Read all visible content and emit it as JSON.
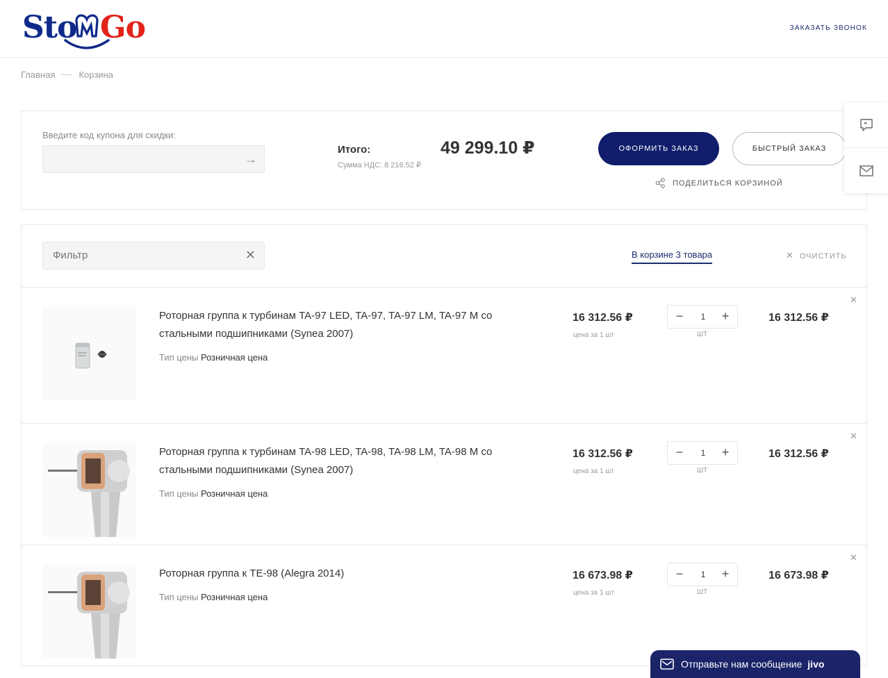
{
  "header": {
    "logo_text_left": "Sto",
    "logo_text_right": "Go",
    "call_link": "ЗАКАЗАТЬ ЗВОНОК"
  },
  "breadcrumb": {
    "home": "Главная",
    "current": "Корзина"
  },
  "summary": {
    "coupon_label": "Введите код купона для скидки:",
    "coupon_value": "",
    "total_label": "Итого:",
    "vat": "Сумма НДС: 8 216.52 ₽",
    "total_amount": "49 299.10 ₽",
    "order_button": "ОФОРМИТЬ ЗАКАЗ",
    "quick_order_button": "БЫСТРЫЙ ЗАКАЗ",
    "share_button": "ПОДЕЛИТЬСЯ КОРЗИНОЙ"
  },
  "cart": {
    "filter_placeholder": "Фильтр",
    "count_text": "В корзине 3 товара",
    "clear_label": "ОЧИСТИТЬ",
    "price_type_label": "Тип цены",
    "per_unit_label": "цена за 1 шт",
    "unit_label": "шт",
    "items": [
      {
        "name": "Роторная группа к турбинам TA-97 LED, TA-97, TA-97 LM, TA-97 M со стальными подшипниками (Synea 2007)",
        "price_type": "Розничная цена",
        "price": "16 312.56 ₽",
        "qty": "1",
        "sum": "16 312.56 ₽",
        "thumb_icon": "rotor-cartridge-image"
      },
      {
        "name": "Роторная группа к турбинам TA-98 LED, TA-98, TA-98 LM, TA-98 M со стальными подшипниками (Synea 2007)",
        "price_type": "Розничная цена",
        "price": "16 312.56 ₽",
        "qty": "1",
        "sum": "16 312.56 ₽",
        "thumb_icon": "turbine-head-image"
      },
      {
        "name": "Роторная группа к TE-98 (Alegra 2014)",
        "price_type": "Розничная цена",
        "price": "16 673.98 ₽",
        "qty": "1",
        "sum": "16 673.98 ₽",
        "thumb_icon": "turbine-head-image"
      }
    ]
  },
  "chat": {
    "label": "Отправьте нам сообщение",
    "brand": "jivo"
  },
  "colors": {
    "primary": "#0f1d6b",
    "logo_blue": "#0f2a8a",
    "logo_red": "#e2231a"
  }
}
